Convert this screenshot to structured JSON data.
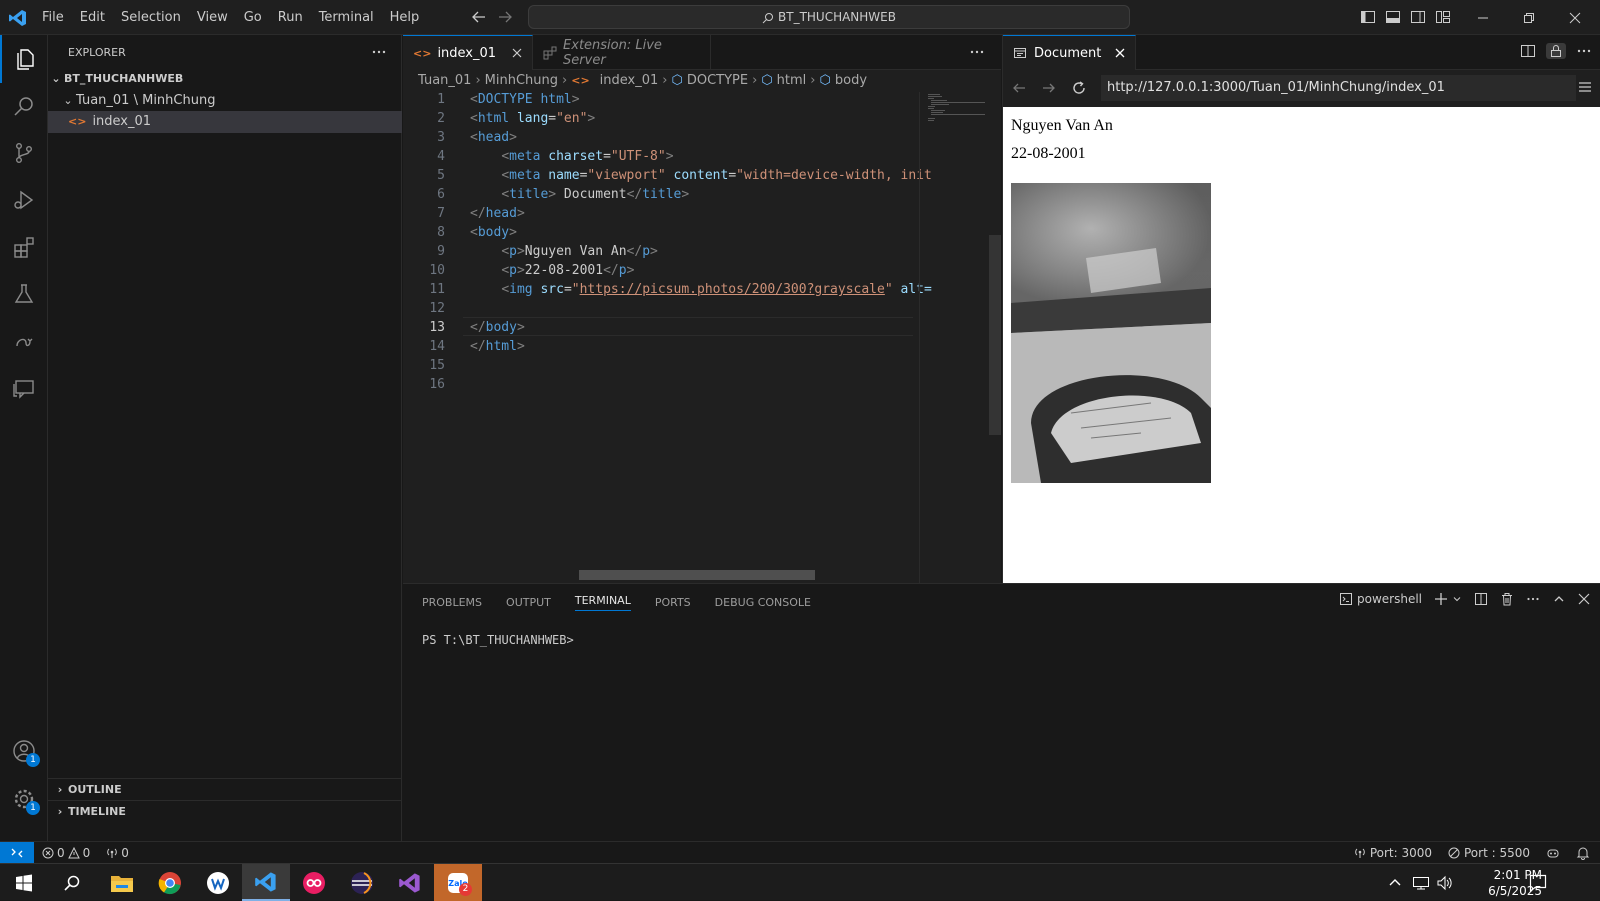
{
  "menu": [
    "File",
    "Edit",
    "Selection",
    "View",
    "Go",
    "Run",
    "Terminal",
    "Help"
  ],
  "command_center": "BT_THUCHANHWEB",
  "explorer": {
    "title": "EXPLORER",
    "root": "BT_THUCHANHWEB",
    "folder": "Tuan_01 \\ MinhChung",
    "file": "index_01",
    "outline": "OUTLINE",
    "timeline": "TIMELINE"
  },
  "editor": {
    "tabs": [
      {
        "label": "index_01"
      },
      {
        "label": "Extension: Live Server"
      }
    ],
    "breadcrumb": {
      "b1": "Tuan_01",
      "b2": "MinhChung",
      "b3": "index_01",
      "b4": "DOCTYPE",
      "b5": "html",
      "b6": "body"
    },
    "line_numbers": [
      "1",
      "2",
      "3",
      "4",
      "5",
      "6",
      "7",
      "8",
      "9",
      "10",
      "11",
      "12",
      "13",
      "14",
      "15",
      "16"
    ],
    "current_line": 13,
    "code": {
      "l1_tag": "DOCTYPE",
      "l1_kw": "html",
      "l2_tag": "html",
      "l2_attr": "lang",
      "l2_val": "\"en\"",
      "l3_tag": "head",
      "l4_tag": "meta",
      "l4_attr": "charset",
      "l4_val": "\"UTF-8\"",
      "l5_tag": "meta",
      "l5_attr1": "name",
      "l5_val1": "\"viewport\"",
      "l5_attr2": "content",
      "l5_val2": "\"width=device-width, init",
      "l6_tag": "title",
      "l6_text": " Document",
      "l7_tag": "head",
      "l8_tag": "body",
      "l9_tag": "p",
      "l9_text": "Nguyen Van An",
      "l10_tag": "p",
      "l10_text": "22-08-2001",
      "l11_tag": "img",
      "l11_attr": "src",
      "l11_url": "https://picsum.photos/200/300?grayscale",
      "l11_rest": "alt=",
      "l13_tag": "body",
      "l14_tag": "html"
    }
  },
  "preview": {
    "tab": "Document",
    "url": "http://127.0.0.1:3000/Tuan_01/MinhChung/index_01",
    "name": "Nguyen Van An",
    "date": "22-08-2001"
  },
  "panel": {
    "tabs": [
      "PROBLEMS",
      "OUTPUT",
      "TERMINAL",
      "PORTS",
      "DEBUG CONSOLE"
    ],
    "active_tab": "TERMINAL",
    "shell": "powershell",
    "prompt": "PS T:\\BT_THUCHANHWEB>"
  },
  "status": {
    "errors": "0",
    "warnings": "0",
    "ports_count": "0",
    "port_label": "Port: 3000",
    "port2_label": "Port : 5500"
  },
  "taskbar": {
    "time": "2:01 PM",
    "date": "6/5/2025",
    "zalo_badge": "2"
  },
  "badges": {
    "accounts": "1",
    "settings": "1"
  },
  "colors": {
    "accent": "#0078d4",
    "background": "#181818",
    "editor": "#1f1f1f"
  }
}
